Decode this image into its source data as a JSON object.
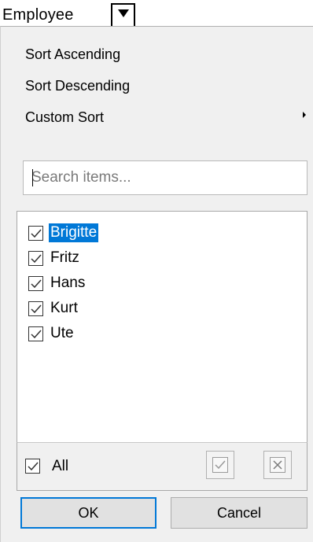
{
  "header": {
    "title": "Employee",
    "dropdown_icon": "dropdown-arrow-icon"
  },
  "menu": {
    "sort_ascending": "Sort Ascending",
    "sort_descending": "Sort Descending",
    "custom_sort": "Custom Sort"
  },
  "search": {
    "placeholder": "Search items..."
  },
  "items": [
    {
      "label": "Brigitte",
      "checked": true,
      "selected": true
    },
    {
      "label": "Fritz",
      "checked": true,
      "selected": false
    },
    {
      "label": "Hans",
      "checked": true,
      "selected": false
    },
    {
      "label": "Kurt",
      "checked": true,
      "selected": false
    },
    {
      "label": "Ute",
      "checked": true,
      "selected": false
    }
  ],
  "footer": {
    "all_label": "All",
    "all_checked": true,
    "check_all_icon": "check-all-icon",
    "uncheck_all_icon": "clear-all-icon"
  },
  "buttons": {
    "ok": "OK",
    "cancel": "Cancel"
  },
  "colors": {
    "selection": "#0078d7",
    "panel_bg": "#f0f0f0",
    "default_button_border": "#0078d7"
  }
}
